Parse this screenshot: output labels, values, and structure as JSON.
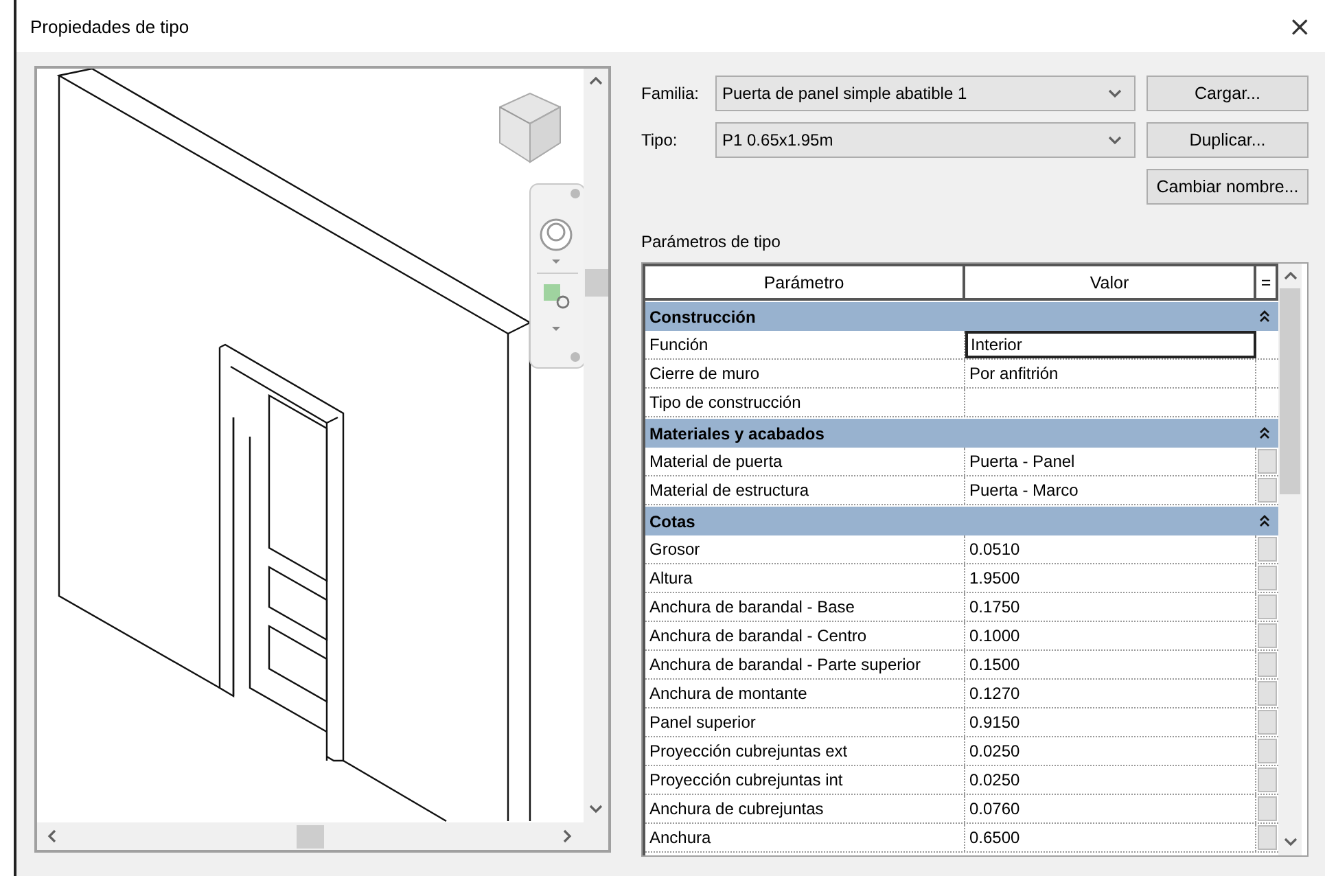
{
  "window": {
    "title": "Propiedades de tipo",
    "close": "×"
  },
  "family": {
    "label": "Familia:",
    "value": "Puerta de panel simple abatible 1"
  },
  "type": {
    "label": "Tipo:",
    "value": "P1 0.65x1.95m"
  },
  "buttons": [
    "Cargar...",
    "Duplicar...",
    "Cambiar nombre..."
  ],
  "params_label": "Parámetros de tipo",
  "table": {
    "columns": [
      "Parámetro",
      "Valor",
      "="
    ],
    "groups": [
      {
        "name": "Construcción",
        "expanded": true,
        "rows": [
          {
            "parameter": "Función",
            "value": "Interior",
            "focused": true,
            "has_button": false
          },
          {
            "parameter": "Cierre de muro",
            "value": "Por anfitrión",
            "focused": false,
            "has_button": false
          },
          {
            "parameter": "Tipo de construcción",
            "value": "",
            "focused": false,
            "has_button": false
          }
        ]
      },
      {
        "name": "Materiales y acabados",
        "expanded": true,
        "rows": [
          {
            "parameter": "Material de puerta",
            "value": "Puerta - Panel",
            "focused": false,
            "has_button": true
          },
          {
            "parameter": "Material de estructura",
            "value": "Puerta - Marco",
            "focused": false,
            "has_button": true
          }
        ]
      },
      {
        "name": "Cotas",
        "expanded": true,
        "rows": [
          {
            "parameter": "Grosor",
            "value": "0.0510",
            "focused": false,
            "has_button": true
          },
          {
            "parameter": "Altura",
            "value": "1.9500",
            "focused": false,
            "has_button": true
          },
          {
            "parameter": "Anchura de barandal - Base",
            "value": "0.1750",
            "focused": false,
            "has_button": true
          },
          {
            "parameter": "Anchura de barandal - Centro",
            "value": "0.1000",
            "focused": false,
            "has_button": true
          },
          {
            "parameter": "Anchura de barandal - Parte superior",
            "value": "0.1500",
            "focused": false,
            "has_button": true
          },
          {
            "parameter": "Anchura de montante",
            "value": "0.1270",
            "focused": false,
            "has_button": true
          },
          {
            "parameter": "Panel superior",
            "value": "0.9150",
            "focused": false,
            "has_button": true
          },
          {
            "parameter": "Proyección cubrejuntas ext",
            "value": "0.0250",
            "focused": false,
            "has_button": true
          },
          {
            "parameter": "Proyección cubrejuntas int",
            "value": "0.0250",
            "focused": false,
            "has_button": true
          },
          {
            "parameter": "Anchura de cubrejuntas",
            "value": "0.0760",
            "focused": false,
            "has_button": true
          },
          {
            "parameter": "Anchura",
            "value": "0.6500",
            "focused": false,
            "has_button": true
          }
        ]
      }
    ]
  }
}
